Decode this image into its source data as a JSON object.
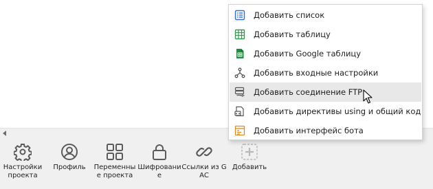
{
  "menu": {
    "items": [
      {
        "label": "Добавить список",
        "icon": "list-icon"
      },
      {
        "label": "Добавить таблицу",
        "icon": "table-icon"
      },
      {
        "label": "Добавить Google таблицу",
        "icon": "google-sheets-icon"
      },
      {
        "label": "Добавить входные настройки",
        "icon": "input-settings-icon"
      },
      {
        "label": "Добавить соединение FTP",
        "icon": "ftp-connection-icon"
      },
      {
        "label": "Добавить директивы using и общий код",
        "icon": "code-directives-icon"
      },
      {
        "label": "Добавить интерфейс бота",
        "icon": "bot-interface-icon"
      }
    ],
    "hovered_index": 4
  },
  "toolbar": {
    "items": [
      {
        "label": "Настройки проекта",
        "icon": "gear-icon"
      },
      {
        "label": "Профиль",
        "icon": "profile-icon"
      },
      {
        "label": "Переменные проекта",
        "icon": "variables-grid-icon"
      },
      {
        "label": "Шифрование",
        "icon": "lock-icon"
      },
      {
        "label": "Ссылки из GAC",
        "icon": "link-icon"
      },
      {
        "label": "Добавить",
        "icon": "add-icon"
      }
    ]
  },
  "colors": {
    "list_icon": "#2f6fd0",
    "table_icon": "#2e9e4f",
    "sheets_icon": "#1e8e3e",
    "ftp_icon": "#555555",
    "bot_icon": "#e08a1e",
    "toolbar_icon": "#5a5a5a"
  }
}
